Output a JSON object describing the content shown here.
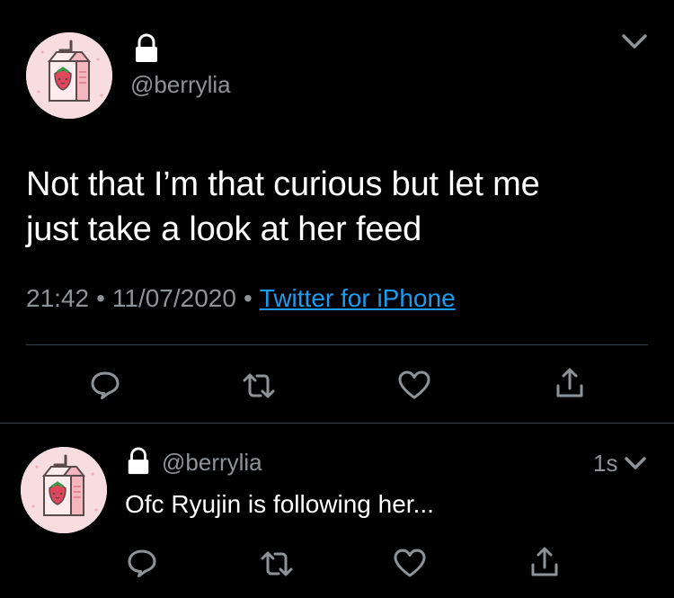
{
  "main_tweet": {
    "handle": "@berrylia",
    "text_line1": "Not that I’m that curious but let me",
    "text_line2": "just take a look at her feed",
    "time": "21:42",
    "date": "11/07/2020",
    "source": "Twitter for iPhone"
  },
  "reply_tweet": {
    "handle": "@berrylia",
    "timestamp": "1s",
    "text": "Ofc Ryujin is following her..."
  },
  "icons": {
    "lock": "lock-icon",
    "chevron": "chevron-down-icon",
    "reply": "reply-icon",
    "retweet": "retweet-icon",
    "like": "heart-icon",
    "share": "share-icon"
  },
  "colors": {
    "background": "#000000",
    "text": "#ffffff",
    "secondary": "#8e9398",
    "link": "#1d9bf0",
    "divider": "#38444d",
    "avatar_bg": "#f7dde0"
  }
}
